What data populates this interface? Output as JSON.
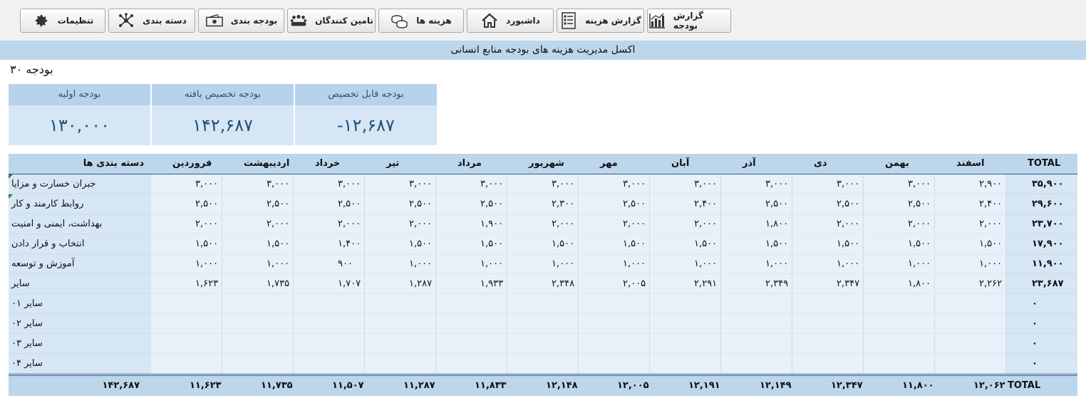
{
  "toolbar": {
    "buttons": [
      {
        "label": "تنظیمات",
        "icon": "gear-icon"
      },
      {
        "label": "دسته بندی",
        "icon": "network-icon"
      },
      {
        "label": "بودجه بندی",
        "icon": "money-icon"
      },
      {
        "label": "تامین کنندگان",
        "icon": "people-icon"
      },
      {
        "label": "هزینه ها",
        "icon": "coins-icon"
      },
      {
        "label": "داشبورد",
        "icon": "home-icon"
      },
      {
        "label": "گزارش هزینه",
        "icon": "checklist-icon"
      },
      {
        "label": "گزارش بودجه",
        "icon": "bar-chart-icon"
      }
    ]
  },
  "banner": "اکسل مدیریت هزینه های بودجه منابع انسانی",
  "title": "بودجه ۳۰",
  "cards": [
    {
      "label": "بودجه اولیه",
      "value": "۱۳۰,۰۰۰"
    },
    {
      "label": "بودجه تخصیص یافته",
      "value": "۱۴۲,۶۸۷"
    },
    {
      "label": "بودجه قابل تخصیص",
      "value": "-۱۲,۶۸۷"
    }
  ],
  "table": {
    "header": {
      "name": "دسته بندی ها",
      "months": [
        "فروردین",
        "اردیبهشت",
        "خرداد",
        "تیر",
        "مرداد",
        "شهریور",
        "مهر",
        "آبان",
        "آذر",
        "دی",
        "بهمن",
        "اسفند"
      ],
      "total": "TOTAL"
    },
    "rows": [
      {
        "name": "جبران خسارت و مزایا",
        "values": [
          "۳,۰۰۰",
          "۳,۰۰۰",
          "۳,۰۰۰",
          "۳,۰۰۰",
          "۳,۰۰۰",
          "۳,۰۰۰",
          "۳,۰۰۰",
          "۳,۰۰۰",
          "۳,۰۰۰",
          "۳,۰۰۰",
          "۳,۰۰۰",
          "۲,۹۰۰"
        ],
        "total": "۳۵,۹۰۰"
      },
      {
        "name": "روابط کارمند و کار",
        "values": [
          "۲,۵۰۰",
          "۲,۵۰۰",
          "۲,۵۰۰",
          "۲,۵۰۰",
          "۲,۵۰۰",
          "۲,۳۰۰",
          "۲,۵۰۰",
          "۲,۴۰۰",
          "۲,۵۰۰",
          "۲,۵۰۰",
          "۲,۵۰۰",
          "۲,۴۰۰"
        ],
        "total": "۲۹,۶۰۰"
      },
      {
        "name": "بهداشت، ایمنی و امنیت",
        "values": [
          "۲,۰۰۰",
          "۲,۰۰۰",
          "۲,۰۰۰",
          "۲,۰۰۰",
          "۱,۹۰۰",
          "۲,۰۰۰",
          "۲,۰۰۰",
          "۲,۰۰۰",
          "۱,۸۰۰",
          "۲,۰۰۰",
          "۲,۰۰۰",
          "۲,۰۰۰"
        ],
        "total": "۲۳,۷۰۰"
      },
      {
        "name": "انتخاب و قرار دادن",
        "values": [
          "۱,۵۰۰",
          "۱,۵۰۰",
          "۱,۴۰۰",
          "۱,۵۰۰",
          "۱,۵۰۰",
          "۱,۵۰۰",
          "۱,۵۰۰",
          "۱,۵۰۰",
          "۱,۵۰۰",
          "۱,۵۰۰",
          "۱,۵۰۰",
          "۱,۵۰۰"
        ],
        "total": "۱۷,۹۰۰"
      },
      {
        "name": "آموزش و توسعه",
        "values": [
          "۱,۰۰۰",
          "۱,۰۰۰",
          "۹۰۰",
          "۱,۰۰۰",
          "۱,۰۰۰",
          "۱,۰۰۰",
          "۱,۰۰۰",
          "۱,۰۰۰",
          "۱,۰۰۰",
          "۱,۰۰۰",
          "۱,۰۰۰",
          "۱,۰۰۰"
        ],
        "total": "۱۱,۹۰۰"
      },
      {
        "name": "سایر",
        "values": [
          "۱,۶۲۳",
          "۱,۷۳۵",
          "۱,۷۰۷",
          "۱,۲۸۷",
          "۱,۹۳۳",
          "۲,۳۴۸",
          "۲,۰۰۵",
          "۲,۲۹۱",
          "۲,۳۴۹",
          "۲,۳۴۷",
          "۱,۸۰۰",
          "۲,۲۶۲"
        ],
        "total": "۲۳,۶۸۷"
      },
      {
        "name": "سایر ۰۱",
        "values": [
          "",
          "",
          "",
          "",
          "",
          "",
          "",
          "",
          "",
          "",
          "",
          ""
        ],
        "total": "۰"
      },
      {
        "name": "سایر ۰۲",
        "values": [
          "",
          "",
          "",
          "",
          "",
          "",
          "",
          "",
          "",
          "",
          "",
          ""
        ],
        "total": "۰"
      },
      {
        "name": "سایر ۰۳",
        "values": [
          "",
          "",
          "",
          "",
          "",
          "",
          "",
          "",
          "",
          "",
          "",
          ""
        ],
        "total": "۰"
      },
      {
        "name": "سایر ۰۴",
        "values": [
          "",
          "",
          "",
          "",
          "",
          "",
          "",
          "",
          "",
          "",
          "",
          ""
        ],
        "total": "۰"
      }
    ],
    "totals": {
      "label": "TOTAL",
      "values": [
        "۱۱,۶۲۳",
        "۱۱,۷۳۵",
        "۱۱,۵۰۷",
        "۱۱,۲۸۷",
        "۱۱,۸۳۳",
        "۱۲,۱۴۸",
        "۱۲,۰۰۵",
        "۱۲,۱۹۱",
        "۱۲,۱۴۹",
        "۱۲,۳۴۷",
        "۱۱,۸۰۰",
        "۱۲,۰۶۲"
      ],
      "total": "۱۴۲,۶۸۷"
    }
  },
  "colors": {
    "header_bg": "#bcd6ec",
    "cell_bg": "#e8f0f9",
    "name_bg": "#d6e6f4",
    "value_text": "#1f4e78",
    "comment_flag": "#1e8a2e"
  }
}
